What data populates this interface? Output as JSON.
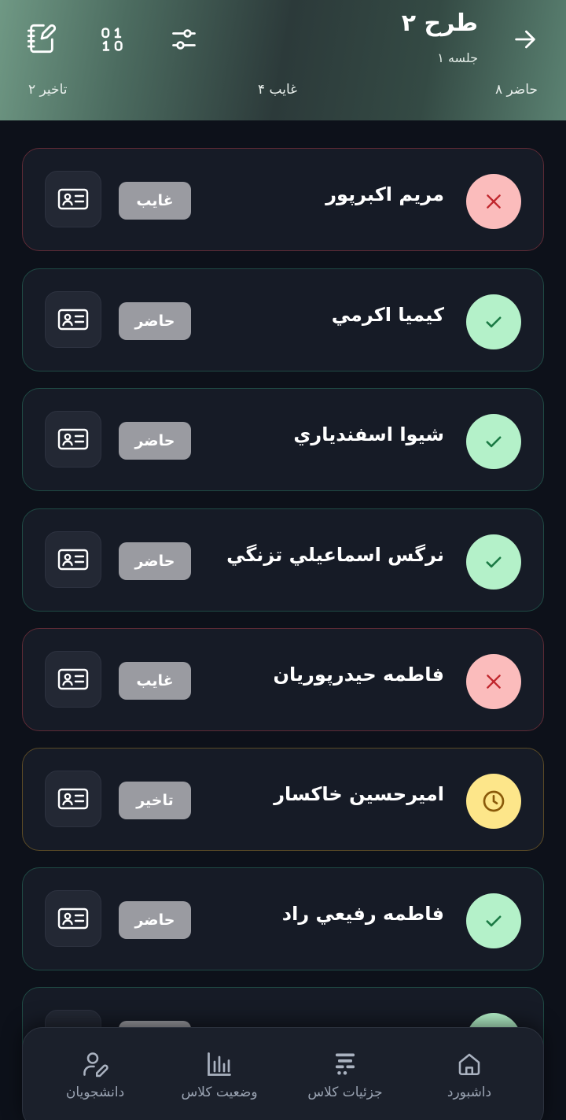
{
  "header": {
    "title": "طرح ۲",
    "subtitle": "جلسه ۱",
    "stats": {
      "present": "۸ حاضر",
      "absent": "۴ غايب",
      "late": "۲ تاخير"
    }
  },
  "students": [
    {
      "name": "مريم اكبرپور",
      "status": "غايب"
    },
    {
      "name": "كيميا اكرمي",
      "status": "حاضر"
    },
    {
      "name": "شيوا اسفندياري",
      "status": "حاضر"
    },
    {
      "name": "نرگس اسماعيلي تزنگي",
      "status": "حاضر"
    },
    {
      "name": "فاطمه حيدرپوريان",
      "status": "غايب"
    },
    {
      "name": "اميرحسين خاكسار",
      "status": "تاخير"
    },
    {
      "name": "فاطمه رفيعي راد",
      "status": "حاضر"
    },
    {
      "name": "",
      "status": ""
    }
  ],
  "nav": {
    "dashboard": "داشبورد",
    "class_details": "جزئيات كلاس",
    "class_status": "وضعيت كلاس",
    "students": "دانشجويان"
  },
  "colors": {
    "present": "#b4f1c9",
    "absent": "#fbbcbc",
    "late": "#fde68a",
    "badge": "#9a9ba1"
  }
}
